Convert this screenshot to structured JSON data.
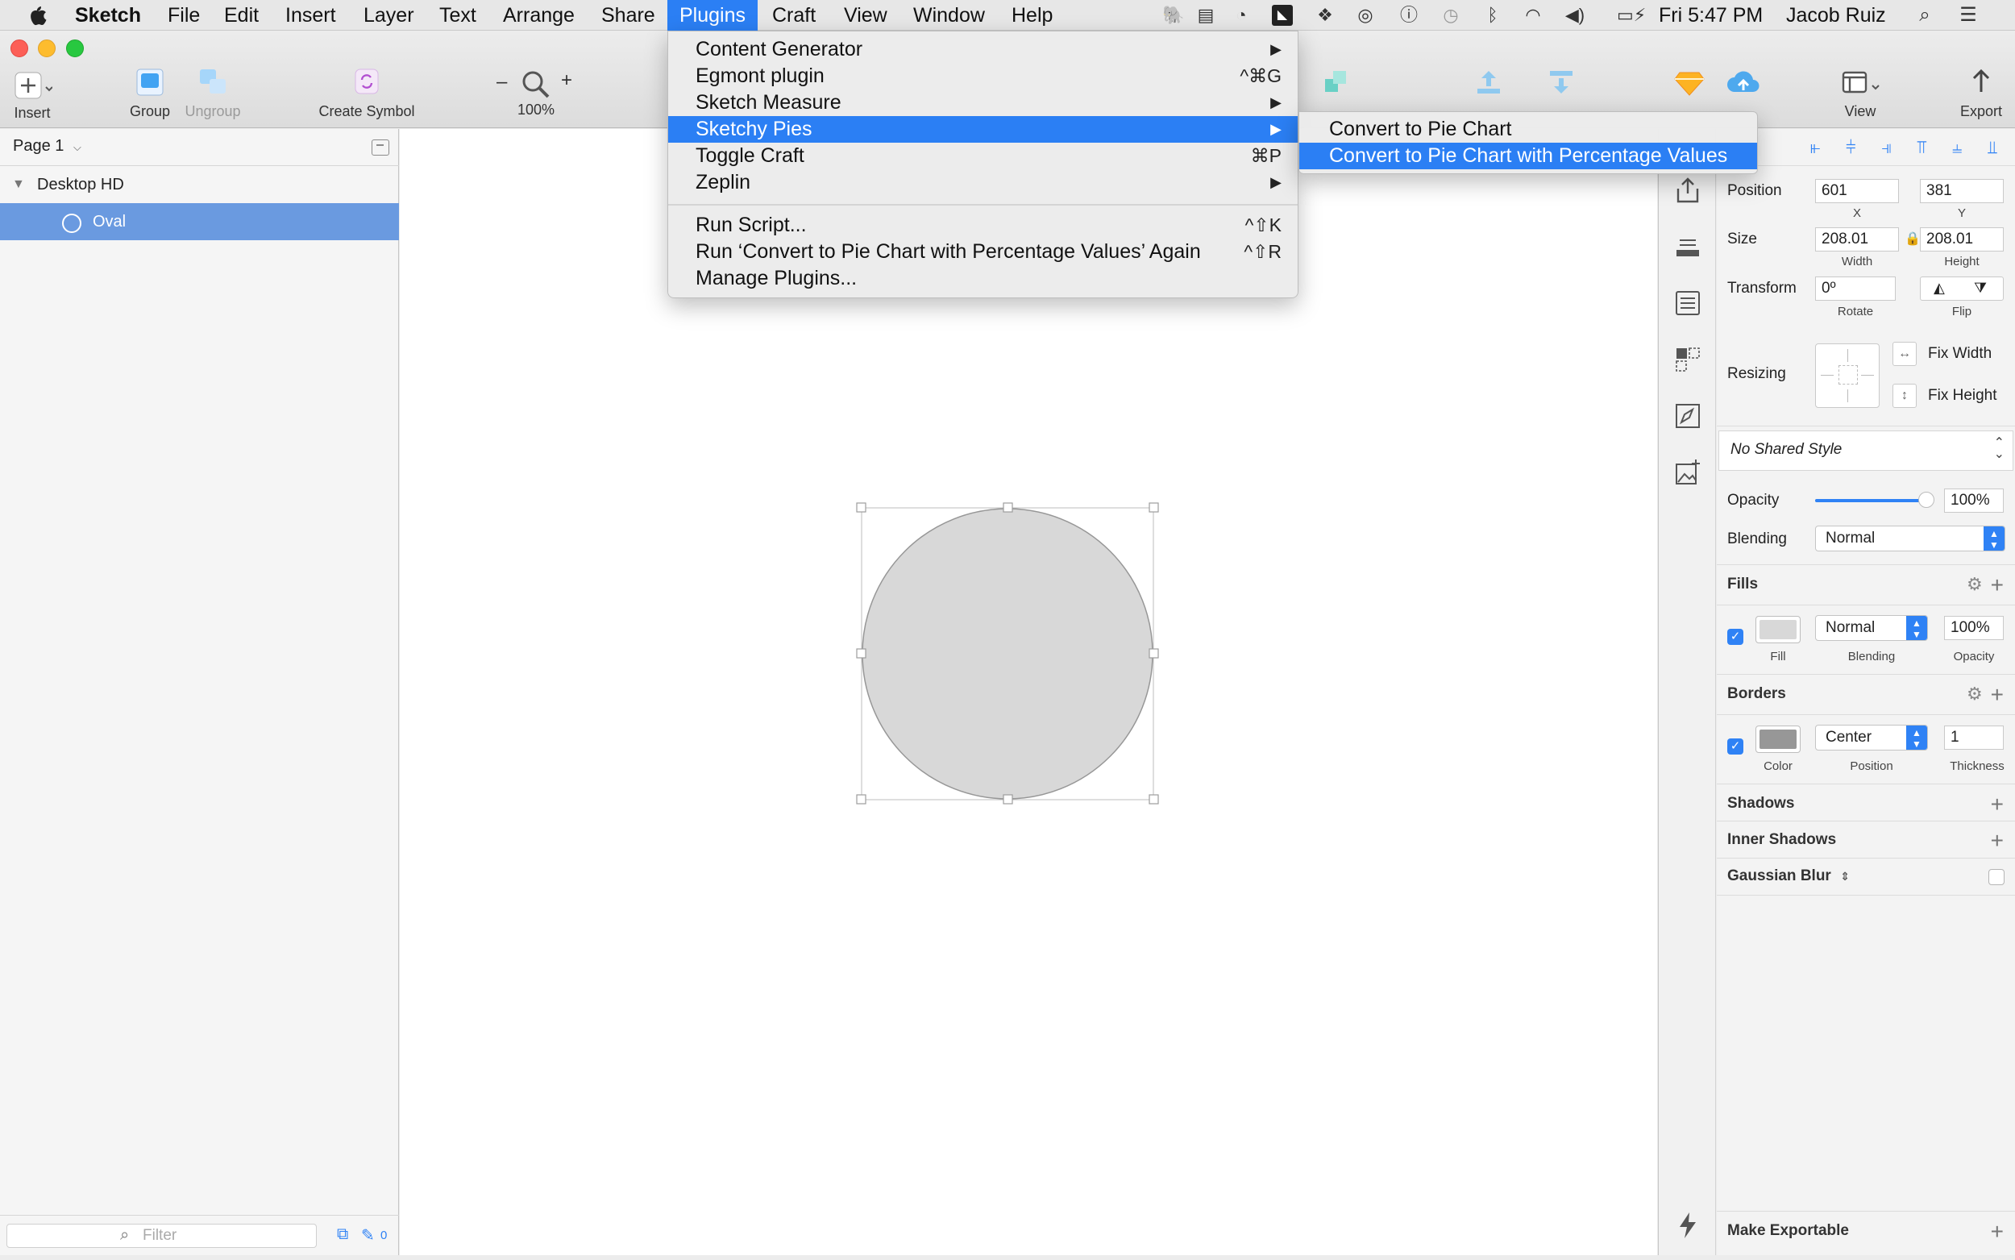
{
  "menubar": {
    "app": "Sketch",
    "items": [
      "File",
      "Edit",
      "Insert",
      "Layer",
      "Text",
      "Arrange",
      "Share",
      "Plugins",
      "Craft",
      "View",
      "Window",
      "Help"
    ],
    "clock": "Fri 5:47 PM",
    "user": "Jacob Ruiz"
  },
  "toolbar": {
    "insert": "Insert",
    "group": "Group",
    "ungroup": "Ungroup",
    "create_symbol": "Create Symbol",
    "zoom_minus": "–",
    "zoom_plus": "+",
    "zoom": "100%",
    "view": "View",
    "export": "Export"
  },
  "plugins_menu": {
    "items": [
      {
        "label": "Content Generator",
        "shortcut": "▶"
      },
      {
        "label": "Egmont plugin",
        "shortcut": "^⌘G"
      },
      {
        "label": "Sketch Measure",
        "shortcut": "▶"
      },
      {
        "label": "Sketchy Pies",
        "shortcut": "▶"
      },
      {
        "label": "Toggle Craft",
        "shortcut": "⌘P"
      },
      {
        "label": "Zeplin",
        "shortcut": "▶"
      }
    ],
    "actions": [
      {
        "label": "Run Script...",
        "shortcut": "^⇧K"
      },
      {
        "label": "Run ‘Convert to Pie Chart with Percentage Values’ Again",
        "shortcut": "^⇧R"
      },
      {
        "label": "Manage Plugins...",
        "shortcut": ""
      }
    ]
  },
  "submenu": {
    "items": [
      "Convert to Pie Chart",
      "Convert to Pie Chart with Percentage Values"
    ]
  },
  "layers": {
    "page": "Page 1",
    "artboard": "Desktop HD",
    "selected": "Oval",
    "filter_placeholder": "Filter",
    "count": "0"
  },
  "inspector": {
    "position_label": "Position",
    "x": "601",
    "x_label": "X",
    "y": "381",
    "y_label": "Y",
    "size_label": "Size",
    "width": "208.01",
    "width_label": "Width",
    "height": "208.01",
    "height_label": "Height",
    "transform_label": "Transform",
    "rotate": "0º",
    "rotate_label": "Rotate",
    "flip_label": "Flip",
    "resizing_label": "Resizing",
    "fix_width": "Fix Width",
    "fix_height": "Fix Height",
    "shared_style": "No Shared Style",
    "opacity_label": "Opacity",
    "opacity": "100%",
    "opacity_fraction": 1.0,
    "blending_label": "Blending",
    "blending": "Normal",
    "fills": {
      "title": "Fills",
      "blending": "Normal",
      "opacity": "100%",
      "fill_label": "Fill",
      "blending_label": "Blending",
      "opacity_label": "Opacity",
      "color": "#d8d8d8"
    },
    "borders": {
      "title": "Borders",
      "position": "Center",
      "thickness": "1",
      "color_label": "Color",
      "position_label": "Position",
      "thickness_label": "Thickness",
      "color": "#979797"
    },
    "shadows": "Shadows",
    "inner_shadows": "Inner Shadows",
    "gaussian_blur": "Gaussian Blur",
    "make_exportable": "Make Exportable"
  },
  "colors": {
    "accent": "#2b7ff4",
    "selection": "#6a9ae0",
    "oval_fill": "#d8d8d8",
    "oval_border": "#979797"
  }
}
